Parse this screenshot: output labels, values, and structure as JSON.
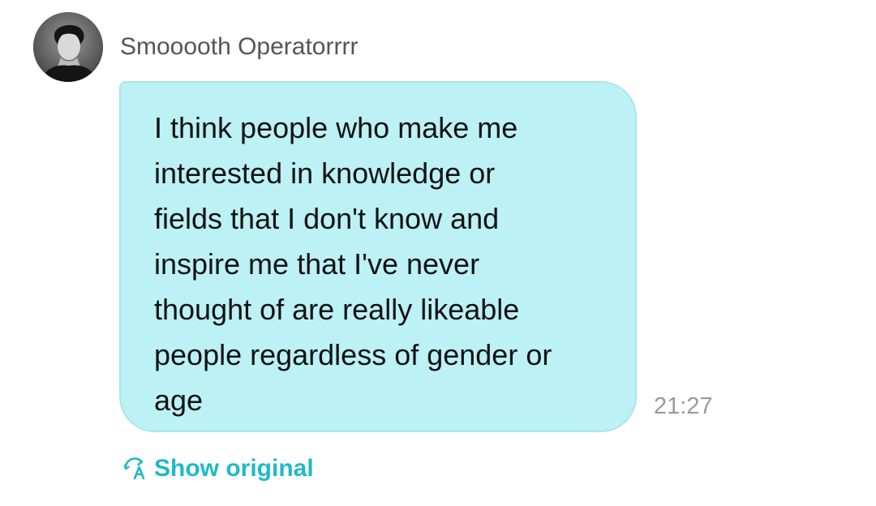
{
  "message": {
    "sender": {
      "name": "Smooooth Operatorrrr",
      "avatar_icon": "avatar-photo"
    },
    "text": "I think people who make me\ninterested in knowledge or\nfields that I don't know and\ninspire me that I've never\nthought of are really likeable\npeople regardless of gender or\nage",
    "time": "21:27",
    "bubble_color": "#bcf1f5"
  },
  "translation": {
    "toggle_label": "Show original",
    "toggle_icon": "translate-icon",
    "accent_color": "#1fb9c9"
  }
}
